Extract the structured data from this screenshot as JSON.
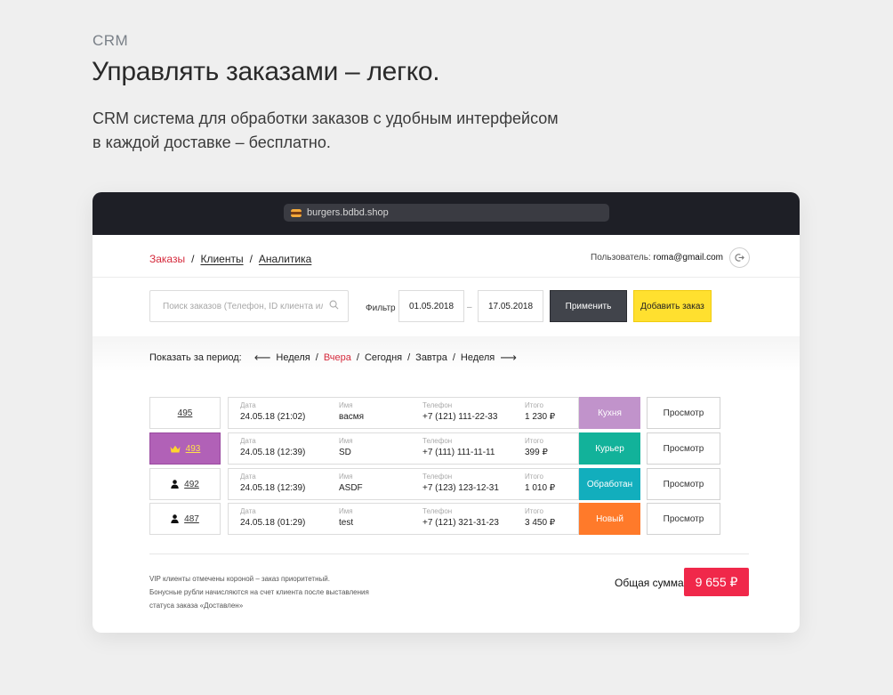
{
  "hero": {
    "tag": "CRM",
    "title": "Управлять заказами – легко.",
    "subtitle_line1": "CRM система для обработки заказов с удобным интерфейсом",
    "subtitle_line2": "в каждой доставке – бесплатно."
  },
  "browser": {
    "url": "burgers.bdbd.shop",
    "favicon": "burger-icon"
  },
  "nav": {
    "crumbs": [
      "Заказы",
      "Клиенты",
      "Аналитика"
    ],
    "separator": "/",
    "user_label": "Пользователь:",
    "user_email": "roma@gmail.com"
  },
  "toolbar": {
    "search_placeholder": "Поиск заказов (Телефон, ID клиента или заказа)",
    "filter_label": "Фильтр",
    "date_from": "01.05.2018",
    "date_to": "17.05.2018",
    "dash": "–",
    "apply_label": "Применить",
    "add_label": "Добавить заказ"
  },
  "period": {
    "label": "Показать за период:",
    "items": [
      "Неделя",
      "Вчера",
      "Сегодня",
      "Завтра",
      "Неделя"
    ],
    "sep": "/",
    "left_arrow": "⟵",
    "right_arrow": "⟶"
  },
  "columns": {
    "date": "Дата",
    "name": "Имя",
    "phone": "Телефон",
    "total": "Итого"
  },
  "orders": [
    {
      "id": "495",
      "date": "24.05.18 (21:02)",
      "name": "васмя",
      "phone": "+7 (121) 111-22-33",
      "total": "1 230 ₽",
      "status": "Кухня",
      "status_color": "#c193cb",
      "view": "Просмотр",
      "type": "none"
    },
    {
      "id": "493",
      "date": "24.05.18 (12:39)",
      "name": "SD",
      "phone": "+7 (111) 111-11-11",
      "total": "399 ₽",
      "status": "Курьер",
      "status_color": "#12b29a",
      "view": "Просмотр",
      "type": "vip"
    },
    {
      "id": "492",
      "date": "24.05.18 (12:39)",
      "name": "ASDF",
      "phone": "+7 (123) 123-12-31",
      "total": "1 010 ₽",
      "status": "Обработан",
      "status_color": "#12aebd",
      "view": "Просмотр",
      "type": "user"
    },
    {
      "id": "487",
      "date": "24.05.18 (01:29)",
      "name": "test",
      "phone": "+7 (121) 321-31-23",
      "total": "3 450 ₽",
      "status": "Новый",
      "status_color": "#ff7a2a",
      "view": "Просмотр",
      "type": "user"
    }
  ],
  "footer": {
    "note1": "VIP клиенты отмечены короной – заказ приоритетный.",
    "note2": "Бонусные рубли начисляются на счет клиента после выставления",
    "note3": "статуса заказа «Доставлен»",
    "total_label": "Общая сумма",
    "total_value": "9 655 ₽"
  }
}
